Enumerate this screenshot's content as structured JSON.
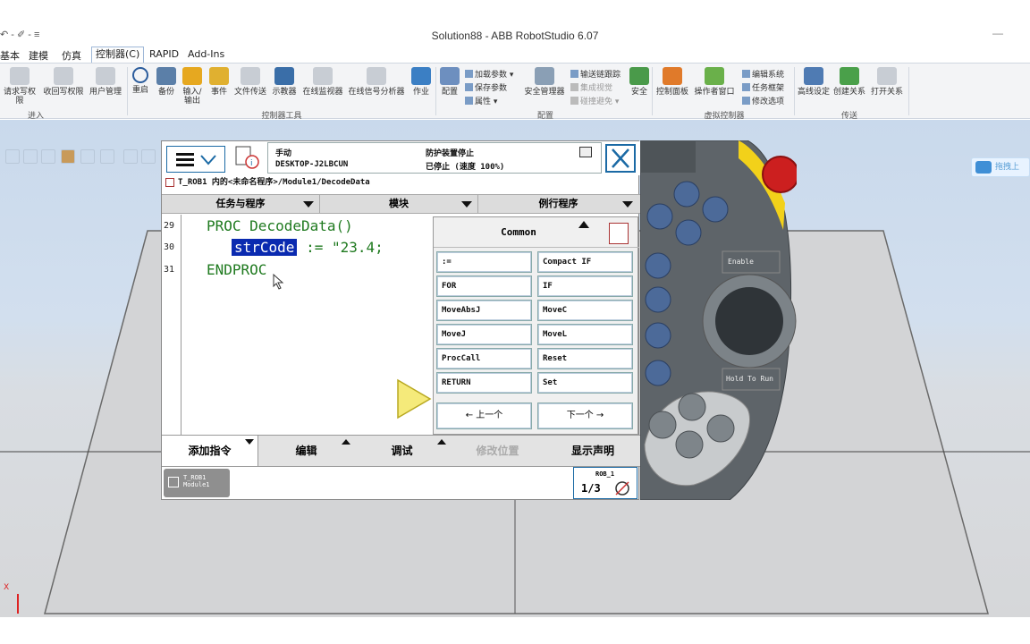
{
  "window": {
    "title": "Solution88 - ABB RobotStudio 6.07",
    "qa_toolbar": "↶ - ✐ - ≡",
    "minimize": "—"
  },
  "menu": [
    "基本",
    "建模",
    "仿真",
    "控制器(C)",
    "RAPID",
    "Add-Ins"
  ],
  "ribbon": {
    "buttons": [
      "请求写权限",
      "收回写权限",
      "用户管理",
      "重启",
      "备份",
      "输入/\n输出",
      "事件",
      "文件传送",
      "示教器",
      "在线监视器",
      "在线信号分析器",
      "作业",
      "配置",
      "安全管理器",
      "安全",
      "控制面板",
      "操作者窗口",
      "高线设定",
      "创建关系",
      "打开关系"
    ],
    "small": [
      "加载参数 ▾",
      "保存参数",
      "属性 ▾",
      "输送链跟踪",
      "集成视觉",
      "碰撞避免 ▾",
      "编辑系统",
      "任务框架",
      "修改选项"
    ],
    "groups": [
      "进入",
      "控制器工具",
      "配置",
      "虚拟控制器",
      "传送"
    ]
  },
  "flexpendant": {
    "status": {
      "mode": "手动",
      "host": "DESKTOP-J2LBCUN",
      "guard": "防护装置停止",
      "state": "已停止 (速度 100%)"
    },
    "path": "T_ROB1 内的<未命名程序>/Module1/DecodeData",
    "tabs": [
      "任务与程序",
      "模块",
      "例行程序"
    ],
    "code": {
      "line_numbers": [
        "29",
        "30",
        "31"
      ],
      "lines": [
        "PROC DecodeData()",
        ":= \"23.4;",
        "ENDPROC"
      ],
      "selected": "strCode"
    },
    "common": {
      "header": "Common",
      "items": [
        ":=",
        "Compact IF",
        "FOR",
        "IF",
        "MoveAbsJ",
        "MoveC",
        "MoveJ",
        "MoveL",
        "ProcCall",
        "Reset",
        "RETURN",
        "Set"
      ],
      "prev": "←  上一个",
      "next": "下一个  →"
    },
    "bottom": [
      "添加指令",
      "编辑",
      "调试",
      "修改位置",
      "显示声明"
    ],
    "task": {
      "line1": "T_ROB1",
      "line2": "Module1"
    },
    "rob": {
      "label": "ROB_1",
      "fraction": "1/3"
    }
  },
  "pendant": {
    "enable": "Enable",
    "hold": "Hold To Run"
  },
  "hint": "拖拽上",
  "axis_label": "X",
  "colors": {
    "accent": "#1b6aa5",
    "code": "#1f7a1f",
    "select": "#0a2ab0",
    "stop": "#cc1f1f",
    "yellow": "#f2d11a"
  }
}
